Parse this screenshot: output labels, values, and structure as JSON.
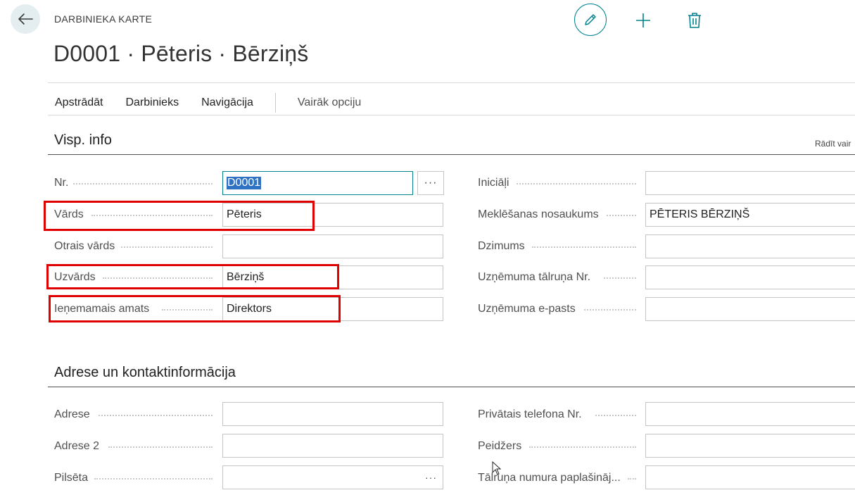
{
  "header": {
    "caption": "DARBINIEKA KARTE",
    "title": "D0001 · Pēteris · Bērziņš"
  },
  "actions": {
    "back_icon": "arrow-left-icon",
    "edit_icon": "pencil-icon",
    "add_icon": "plus-icon",
    "delete_icon": "trash-icon",
    "accent_color": "#00838f"
  },
  "menu": {
    "items": [
      "Apstrādāt",
      "Darbinieks",
      "Navigācija"
    ],
    "more": "Vairāk opciju"
  },
  "general": {
    "title": "Visp. info",
    "show_more": "Rādīt vair",
    "left": [
      {
        "label": "Nr.",
        "value": "D0001"
      },
      {
        "label": "Vārds",
        "value": "Pēteris"
      },
      {
        "label": "Otrais vārds",
        "value": ""
      },
      {
        "label": "Uzvārds",
        "value": "Bērziņš"
      },
      {
        "label": "Ieņemamais amats",
        "value": "Direktors"
      }
    ],
    "right": [
      {
        "label": "Iniciāļi",
        "value": ""
      },
      {
        "label": "Meklēšanas nosaukums",
        "value": "PĒTERIS BĒRZIŅŠ"
      },
      {
        "label": "Dzimums",
        "value": ""
      },
      {
        "label": "Uzņēmuma tālruņa Nr.",
        "value": ""
      },
      {
        "label": "Uzņēmuma e-pasts",
        "value": ""
      }
    ]
  },
  "address": {
    "title": "Adrese un kontaktinformācija",
    "left": [
      {
        "label": "Adrese",
        "value": ""
      },
      {
        "label": "Adrese 2",
        "value": ""
      },
      {
        "label": "Pilsēta",
        "value": ""
      }
    ],
    "right": [
      {
        "label": "Privātais telefona Nr.",
        "value": ""
      },
      {
        "label": "Peidžers",
        "value": ""
      },
      {
        "label": "Tālruņa numura paplašināj...",
        "value": ""
      }
    ]
  },
  "highlight_color": "#e00000"
}
